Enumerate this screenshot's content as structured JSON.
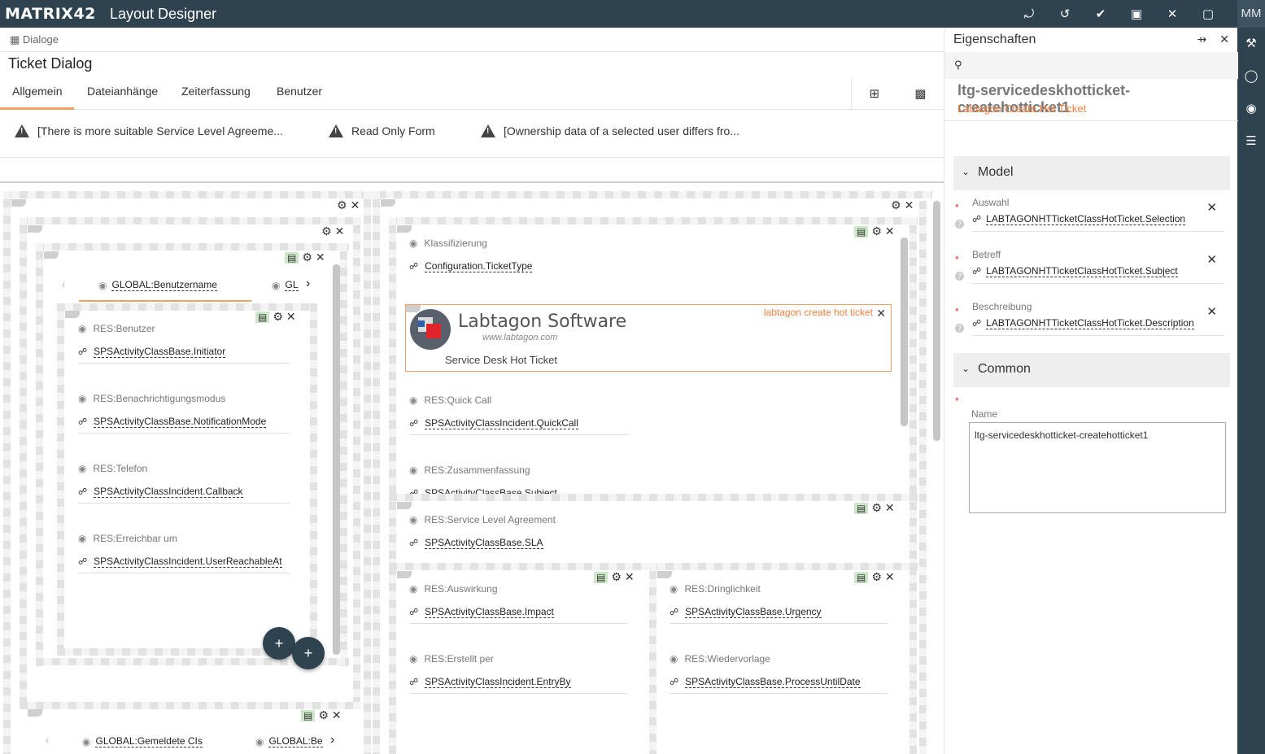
{
  "app": {
    "logo": "MATRIX42",
    "title": "Layout Designer",
    "user_initials": "MM"
  },
  "toolbar_icons": [
    "share-icon",
    "undo-icon",
    "check-all-icon",
    "save-icon",
    "close-icon",
    "comment-icon"
  ],
  "rail_icons": [
    "wrench-icon",
    "tree-icon",
    "globe-icon",
    "sliders-icon"
  ],
  "breadcrumb": "Dialoge",
  "page_title": "Ticket Dialog",
  "tabs": [
    {
      "label": "Allgemein",
      "active": true
    },
    {
      "label": "Dateianhänge",
      "active": false
    },
    {
      "label": "Zeiterfassung",
      "active": false
    },
    {
      "label": "Benutzer",
      "active": false
    }
  ],
  "warnings": [
    "[There is more suitable Service Level Agreeme...",
    "Read Only Form",
    "[Ownership data of a selected user differs fro..."
  ],
  "left_panel": {
    "nav_tabs": [
      "GLOBAL:Benutzername",
      "GL"
    ],
    "fields": [
      {
        "label": "RES:Benutzer",
        "prefix": "SPSActivityClassBase.",
        "name": "Initiator"
      },
      {
        "label": "RES:Benachrichtigungsmodus",
        "prefix": "SPSActivityClassBase.",
        "name": "NotificationMode"
      },
      {
        "label": "RES:Telefon",
        "prefix": "SPSActivityClassIncident.",
        "name": "Callback"
      },
      {
        "label": "RES:Erreichbar um",
        "prefix": "SPSActivityClassIncident.",
        "name": "UserReachableAt"
      }
    ],
    "bottom_tabs": [
      "GLOBAL:Gemeldete CIs",
      "GLOBAL:Be"
    ],
    "fab_label": "+"
  },
  "right_panel": {
    "klass": {
      "label": "Klassifizierung",
      "prefix": "Configuration.",
      "name": "TicketType"
    },
    "hot_ticket": {
      "badge": "labtagon create hot ticket",
      "logo_name": "Labtagon Software",
      "logo_url": "www.labtagon.com",
      "subtitle": "Service Desk Hot Ticket"
    },
    "fields_a": [
      {
        "label": "RES:Quick Call",
        "prefix": "SPSActivityClassIncident.",
        "name": "QuickCall"
      },
      {
        "label": "RES:Zusammenfassung",
        "prefix": "SPSActivityClassBase.",
        "name": "Subject"
      }
    ],
    "sla": {
      "label": "RES:Service Level Agreement",
      "prefix": "SPSActivityClassBase.",
      "name": "SLA"
    },
    "col_left": [
      {
        "label": "RES:Auswirkung",
        "prefix": "SPSActivityClassBase.",
        "name": "Impact"
      },
      {
        "label": "RES:Erstellt per",
        "prefix": "SPSActivityClassIncident.",
        "name": "EntryBy"
      }
    ],
    "col_right": [
      {
        "label": "RES:Dringlichkeit",
        "prefix": "SPSActivityClassBase.",
        "name": "Urgency"
      },
      {
        "label": "RES:Wiedervorlage",
        "prefix": "SPSActivityClassBase.",
        "name": "ProcessUntilDate"
      }
    ]
  },
  "properties": {
    "header": "Eigenschaften",
    "title": "ltg-servicedeskhotticket-createhotticket1",
    "subtitle": "Labtagon Create Hot Ticket",
    "model_section": "Model",
    "model_props": [
      {
        "label": "Auswahl",
        "prefix": "LABTAGONHTTicketClassHotTicket.",
        "name": "Selection"
      },
      {
        "label": "Betreff",
        "prefix": "LABTAGONHTTicketClassHotTicket.",
        "name": "Subject"
      },
      {
        "label": "Beschreibung",
        "prefix": "LABTAGONHTTicketClassHotTicket.",
        "name": "Description"
      }
    ],
    "common_section": "Common",
    "name_label": "Name",
    "name_value": "ltg-servicedeskhotticket-createhotticket1"
  },
  "colors": {
    "topbar": "#2f4250",
    "accent": "#f0a060",
    "required": "#e03030",
    "layout_green": "#cde8c8"
  }
}
